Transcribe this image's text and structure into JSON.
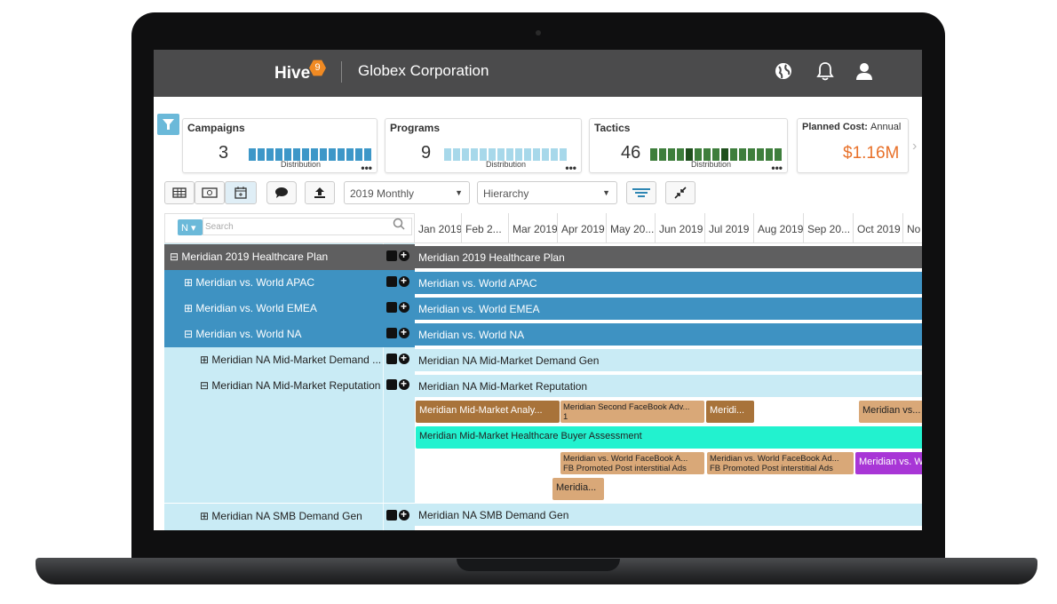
{
  "header": {
    "logo": "Hive",
    "logo_badge": "9",
    "organization": "Globex Corporation"
  },
  "kpis": {
    "campaigns": {
      "title": "Campaigns",
      "value": "3",
      "dist_label": "Distribution",
      "more": "•••"
    },
    "programs": {
      "title": "Programs",
      "value": "9",
      "dist_label": "Distribution",
      "more": "•••"
    },
    "tactics": {
      "title": "Tactics",
      "value": "46",
      "dist_label": "Distribution",
      "more": "•••"
    },
    "cost": {
      "title": "Planned Cost:",
      "period": "Annual",
      "value": "$1.16M"
    }
  },
  "colors": {
    "campaign_bars": "#3d97c8",
    "program_bars": "#a7d8ea",
    "tactic_bars": "#3e7e3c",
    "cost": "#e8712a"
  },
  "toolbar": {
    "period_select": "2019 Monthly",
    "view_select": "Hierarchy",
    "icons": [
      "grid-icon",
      "money-icon",
      "calendar-icon",
      "comment-icon",
      "upload-icon",
      "list-icon",
      "collapse-icon"
    ]
  },
  "search": {
    "filter": "N",
    "placeholder": "Search"
  },
  "months": [
    "Jan 2019",
    "Feb 2...",
    "Mar 2019",
    "Apr 2019",
    "May 20...",
    "Jun 2019",
    "Jul 2019",
    "Aug 2019",
    "Sep 20...",
    "Oct 2019",
    "No"
  ],
  "tree": [
    {
      "toggle": "⊟",
      "label": "Meridian 2019 Healthcare Plan"
    },
    {
      "toggle": "⊞",
      "label": "Meridian vs. World APAC"
    },
    {
      "toggle": "⊞",
      "label": "Meridian vs. World EMEA"
    },
    {
      "toggle": "⊟",
      "label": "Meridian vs. World NA"
    },
    {
      "toggle": "⊞",
      "label": "Meridian NA Mid-Market Demand ..."
    },
    {
      "toggle": "⊟",
      "label": "Meridian NA Mid-Market Reputation"
    },
    {
      "toggle": "⊞",
      "label": "Meridian NA SMB Demand Gen"
    }
  ],
  "bars": [
    "Meridian 2019 Healthcare Plan",
    "Meridian vs. World APAC",
    "Meridian vs. World EMEA",
    "Meridian vs. World NA",
    "Meridian NA Mid-Market Demand Gen",
    "Meridian NA Mid-Market Reputation",
    "Meridian NA SMB Demand Gen"
  ],
  "tactics": [
    {
      "label": "Meridian Mid-Market Analy..."
    },
    {
      "label": "Meridian Second FaceBook Adv...",
      "label2": "1"
    },
    {
      "label": "Meridi..."
    },
    {
      "label": "Meridian vs..."
    },
    {
      "label": "Meridian Mid-Market Healthcare Buyer Assessment"
    },
    {
      "label": "Meridian vs. World FaceBook A...",
      "label2": "FB Promoted Post interstitial Ads"
    },
    {
      "label": "Meridian vs. World FaceBook Ad...",
      "label2": "FB Promoted Post interstitial Ads"
    },
    {
      "label": "Meridian vs. W"
    },
    {
      "label": "Meridia..."
    }
  ]
}
